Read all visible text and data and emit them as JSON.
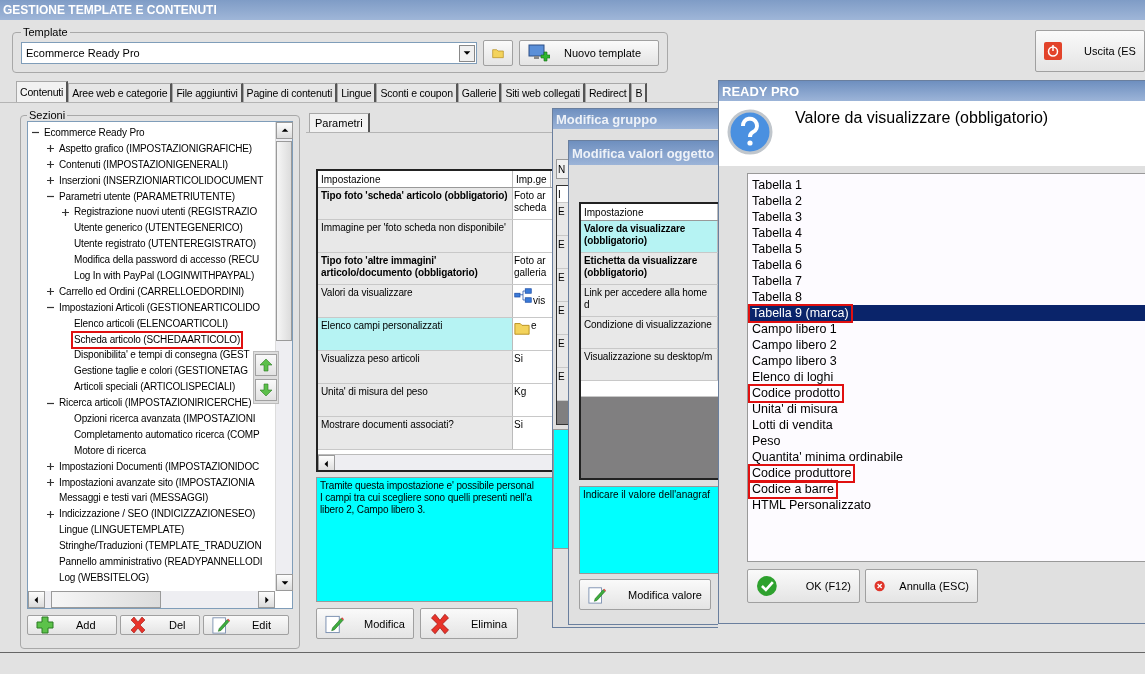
{
  "window": {
    "title": "GESTIONE TEMPLATE E CONTENUTI"
  },
  "template": {
    "label": "Template",
    "value": "Ecommerce Ready Pro",
    "new_button": "Nuovo template"
  },
  "exit_button": "Uscita (ES",
  "tabs": [
    {
      "label": "Contenuti",
      "selected": true
    },
    {
      "label": "Aree web e categorie",
      "selected": false
    },
    {
      "label": "File aggiuntivi",
      "selected": false
    },
    {
      "label": "Pagine di contenuti",
      "selected": false
    },
    {
      "label": "Lingue",
      "selected": false
    },
    {
      "label": "Sconti e coupon",
      "selected": false
    },
    {
      "label": "Gallerie",
      "selected": false
    },
    {
      "label": "Siti web collegati",
      "selected": false
    },
    {
      "label": "Redirect",
      "selected": false
    },
    {
      "label": "B",
      "selected": false
    }
  ],
  "sections": {
    "label": "Sezioni",
    "tree": [
      {
        "label": "Ecommerce Ready Pro",
        "expanded": true,
        "highlighted": false,
        "children": [
          {
            "label": "Aspetto grafico (IMPOSTAZIONIGRAFICHE)",
            "expanded": false,
            "highlighted": false
          },
          {
            "label": "Contenuti (IMPOSTAZIONIGENERALI)",
            "expanded": false,
            "highlighted": false
          },
          {
            "label": "Inserzioni (INSERZIONIARTICOLIDOCUMENT",
            "expanded": false,
            "highlighted": false
          },
          {
            "label": "Parametri utente (PARAMETRIUTENTE)",
            "expanded": true,
            "highlighted": false,
            "children": [
              {
                "label": "Registrazione nuovi utenti (REGISTRAZIO",
                "expanded": false,
                "highlighted": false
              },
              {
                "label": "Utente generico (UTENTEGENERICO)",
                "highlighted": false
              },
              {
                "label": "Utente registrato (UTENTEREGISTRATO)",
                "highlighted": false
              },
              {
                "label": "Modifica della password di accesso (RECU",
                "highlighted": false
              },
              {
                "label": "Log In with PayPal (LOGINWITHPAYPAL)",
                "highlighted": false
              }
            ]
          },
          {
            "label": "Carrello ed Ordini (CARRELLOEDORDINI)",
            "expanded": false,
            "highlighted": false
          },
          {
            "label": "Impostazioni Articoli (GESTIONEARTICOLIDO",
            "expanded": true,
            "highlighted": false,
            "children": [
              {
                "label": "Elenco articoli (ELENCOARTICOLI)",
                "highlighted": false
              },
              {
                "label": "Scheda articolo (SCHEDAARTICOLO)",
                "highlighted": true
              },
              {
                "label": "Disponibilita' e tempi di consegna (GEST",
                "highlighted": false
              },
              {
                "label": "Gestione taglie e colori (GESTIONETAG",
                "highlighted": false
              },
              {
                "label": "Articoli speciali (ARTICOLISPECIALI)",
                "highlighted": false
              }
            ]
          },
          {
            "label": "Ricerca articoli (IMPOSTAZIONIRICERCHE)",
            "expanded": true,
            "highlighted": false,
            "children": [
              {
                "label": "Opzioni ricerca avanzata (IMPOSTAZIONI",
                "highlighted": false
              },
              {
                "label": "Completamento automatico ricerca (COMP",
                "highlighted": false
              },
              {
                "label": "Motore di ricerca",
                "highlighted": false
              }
            ]
          },
          {
            "label": "Impostazioni Documenti (IMPOSTAZIONIDOC",
            "expanded": false,
            "highlighted": false
          },
          {
            "label": "Impostazioni avanzate sito (IMPOSTAZIONIA",
            "expanded": false,
            "highlighted": false
          },
          {
            "label": "Messaggi e testi vari (MESSAGGI)",
            "highlighted": false
          },
          {
            "label": "Indicizzazione / SEO (INDICIZZAZIONESEO)",
            "expanded": false,
            "highlighted": false
          },
          {
            "label": "Lingue (LINGUETEMPLATE)",
            "highlighted": false
          },
          {
            "label": "Stringhe/Traduzioni (TEMPLATE_TRADUZION",
            "highlighted": false
          },
          {
            "label": "Pannello amministrativo (READYPANNELLODI",
            "highlighted": false
          },
          {
            "label": "Log (WEBSITELOG)",
            "highlighted": false
          }
        ]
      }
    ],
    "buttons": [
      {
        "kind": "add",
        "label": "Add"
      },
      {
        "kind": "delete",
        "label": "Del"
      },
      {
        "kind": "edit",
        "label": "Edit"
      }
    ]
  },
  "params": {
    "tab": "Parametri",
    "columns": [
      "Impostazione",
      "Imp.ge"
    ],
    "rows": [
      {
        "kind": "text",
        "setting": "Tipo foto 'scheda' articolo (obbligatorio)",
        "value": "Foto ar scheda",
        "required": true,
        "selected": false
      },
      {
        "kind": "text",
        "setting": "Immagine per 'foto scheda non disponibile'",
        "required": false,
        "selected": false
      },
      {
        "kind": "text",
        "setting": "Tipo foto 'altre immagini' articolo/documento (obbligatorio)",
        "value": "Foto ar galleria",
        "required": true,
        "selected": false
      },
      {
        "kind": "diagram",
        "setting": "Valori da visualizzare",
        "value": "vis",
        "required": false,
        "selected": false
      },
      {
        "kind": "folder",
        "setting": "Elenco campi personalizzati",
        "value": "e",
        "required": false,
        "selected": true
      },
      {
        "kind": "text",
        "setting": "Visualizza peso articoli",
        "value": "Si",
        "required": false,
        "selected": false
      },
      {
        "kind": "text",
        "setting": "Unita' di misura del peso",
        "value": "Kg",
        "required": false,
        "selected": false
      },
      {
        "kind": "text",
        "setting": "Mostrare documenti associati?",
        "value": "Si",
        "required": false,
        "selected": false
      }
    ],
    "description": [
      "Tramite questa impostazione e' possibile personal",
      "I campi tra cui scegliere sono quelli presenti nell'a",
      "libero 2, Campo libero 3."
    ],
    "buttons": [
      {
        "kind": "edit",
        "label": "Modifica"
      },
      {
        "kind": "delete",
        "label": "Elimina"
      }
    ]
  },
  "group_dialog": {
    "title": "Modifica gruppo",
    "field": "N",
    "column": "I",
    "rows": [
      "E",
      "E",
      "E",
      "E",
      "E",
      "E"
    ]
  },
  "values_dialog": {
    "title": "Modifica valori oggetto",
    "column": "Impostazione",
    "rows": [
      {
        "setting": "Valore da visualizzare (obbligatorio)",
        "required": true,
        "selected": true
      },
      {
        "setting": "Etichetta da visualizzare (obbligatorio)",
        "required": true,
        "selected": false
      },
      {
        "setting": "Link per accedere alla home d",
        "required": false,
        "selected": false
      },
      {
        "setting": "Condizione di visualizzazione",
        "required": false,
        "selected": false
      },
      {
        "setting": "Visualizzazione su desktop/m",
        "required": false,
        "selected": false
      }
    ],
    "description": "Indicare il valore dell'anagraf",
    "button": "Modifica valore"
  },
  "choice_dialog": {
    "title": "READY PRO",
    "question": "Valore da visualizzare (obbligatorio)",
    "options": [
      {
        "label": "Tabella 1",
        "selected": false,
        "highlighted": false
      },
      {
        "label": "Tabella 2",
        "selected": false,
        "highlighted": false
      },
      {
        "label": "Tabella 3",
        "selected": false,
        "highlighted": false
      },
      {
        "label": "Tabella 4",
        "selected": false,
        "highlighted": false
      },
      {
        "label": "Tabella 5",
        "selected": false,
        "highlighted": false
      },
      {
        "label": "Tabella 6",
        "selected": false,
        "highlighted": false
      },
      {
        "label": "Tabella 7",
        "selected": false,
        "highlighted": false
      },
      {
        "label": "Tabella 8",
        "selected": false,
        "highlighted": false
      },
      {
        "label": "Tabella 9 (marca)",
        "selected": true,
        "highlighted": true
      },
      {
        "label": "Campo libero 1",
        "selected": false,
        "highlighted": false
      },
      {
        "label": "Campo libero 2",
        "selected": false,
        "highlighted": false
      },
      {
        "label": "Campo libero 3",
        "selected": false,
        "highlighted": false
      },
      {
        "label": "Elenco di loghi",
        "selected": false,
        "highlighted": false
      },
      {
        "label": "Codice prodotto",
        "selected": false,
        "highlighted": true
      },
      {
        "label": "Unita' di misura",
        "selected": false,
        "highlighted": false
      },
      {
        "label": "Lotti di vendita",
        "selected": false,
        "highlighted": false
      },
      {
        "label": "Peso",
        "selected": false,
        "highlighted": false
      },
      {
        "label": "Quantita' minima ordinabile",
        "selected": false,
        "highlighted": false
      },
      {
        "label": "Codice produttore",
        "selected": false,
        "highlighted": true
      },
      {
        "label": "Codice a barre",
        "selected": false,
        "highlighted": true
      },
      {
        "label": "HTML Personalizzato",
        "selected": false,
        "highlighted": false
      }
    ],
    "buttons": [
      {
        "kind": "ok",
        "label": "OK (F12)"
      },
      {
        "kind": "cancel",
        "label": "Annulla (ESC)"
      }
    ]
  }
}
